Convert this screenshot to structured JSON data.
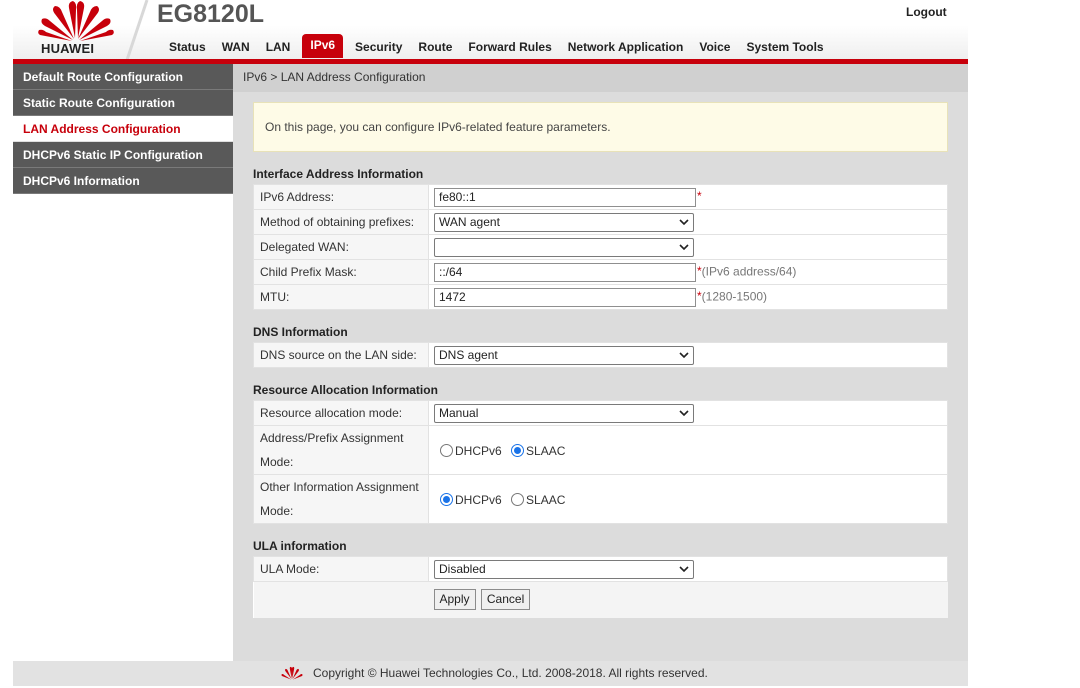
{
  "header": {
    "logo_text": "HUAWEI",
    "product": "EG8120L",
    "logout_label": "Logout",
    "brand_color": "#c7000b",
    "nav": [
      "Status",
      "WAN",
      "LAN",
      "IPv6",
      "Security",
      "Route",
      "Forward Rules",
      "Network Application",
      "Voice",
      "System Tools"
    ],
    "active_nav": "IPv6"
  },
  "sidebar": {
    "items": [
      {
        "label": "Default Route Configuration"
      },
      {
        "label": "Static Route Configuration"
      },
      {
        "label": "LAN Address Configuration"
      },
      {
        "label": "DHCPv6 Static IP Configuration"
      },
      {
        "label": "DHCPv6 Information"
      }
    ],
    "active": "LAN Address Configuration"
  },
  "breadcrumb": "IPv6 > LAN Address Configuration",
  "notice": "On this page, you can configure IPv6-related feature parameters.",
  "interface": {
    "title": "Interface Address Information",
    "ipv6_label": "IPv6 Address:",
    "ipv6_value": "fe80::1",
    "method_label": "Method of obtaining prefixes:",
    "method_value": "WAN agent",
    "delegated_label": "Delegated WAN:",
    "delegated_value": "",
    "mask_label": "Child Prefix Mask:",
    "mask_value": "::/64",
    "mask_hint": "(IPv6 address/64)",
    "mtu_label": "MTU:",
    "mtu_value": "1472",
    "mtu_hint": "(1280-1500)",
    "required_mark": "*"
  },
  "dns": {
    "title": "DNS Information",
    "source_label": "DNS source on the LAN side:",
    "source_value": "DNS agent"
  },
  "resource": {
    "title": "Resource Allocation Information",
    "mode_label": "Resource allocation mode:",
    "mode_value": "Manual",
    "addr_label_1": "Address/Prefix Assignment",
    "addr_label_2": "Mode:",
    "other_label_1": "Other Information Assignment",
    "other_label_2": "Mode:",
    "opt_dhcpv6": "DHCPv6",
    "opt_slaac": "SLAAC",
    "addr_selected": "SLAAC",
    "other_selected": "DHCPv6"
  },
  "ula": {
    "title": "ULA information",
    "mode_label": "ULA Mode:",
    "mode_value": "Disabled"
  },
  "buttons": {
    "apply": "Apply",
    "cancel": "Cancel"
  },
  "footer": {
    "copyright": "Copyright © Huawei Technologies Co., Ltd. 2008-2018. All rights reserved."
  }
}
